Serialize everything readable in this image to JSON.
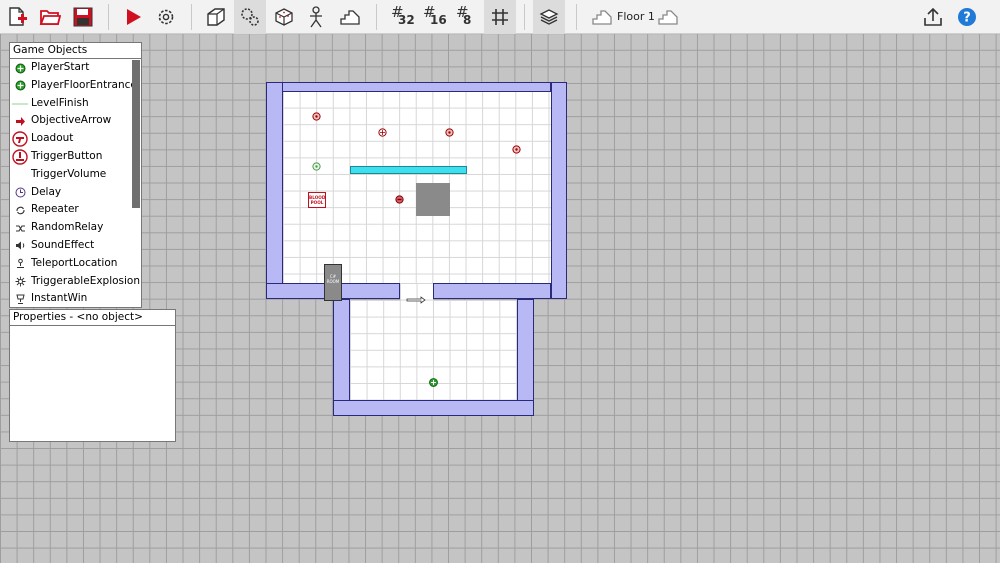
{
  "toolbar": {
    "buttons": [
      {
        "name": "new-level-icon"
      },
      {
        "name": "open-folder-icon"
      },
      {
        "name": "save-icon"
      },
      {
        "name": "play-icon"
      },
      {
        "name": "settings-gear-icon"
      },
      {
        "name": "wall-tool-icon"
      },
      {
        "name": "object-tool-icon"
      },
      {
        "name": "cube-tool-icon"
      },
      {
        "name": "player-figure-icon"
      },
      {
        "name": "stairs-tool-icon"
      }
    ],
    "grid_sizes": [
      "32",
      "16",
      "8"
    ],
    "floor_label": "Floor 1",
    "colors": {
      "accent_red": "#d01020",
      "help_blue": "#1f7ad8"
    }
  },
  "game_objects": {
    "title": "Game Objects",
    "items": [
      {
        "label": "PlayerStart",
        "icon": "green-circle-icon"
      },
      {
        "label": "PlayerFloorEntrance",
        "icon": "green-circle-icon"
      },
      {
        "label": "LevelFinish",
        "icon": "finish-line-icon"
      },
      {
        "label": "ObjectiveArrow",
        "icon": "red-arrow-icon"
      },
      {
        "label": "Loadout",
        "icon": "loadout-icon"
      },
      {
        "label": "TriggerButton",
        "icon": "trigger-button-icon"
      },
      {
        "label": "TriggerVolume",
        "icon": "none"
      },
      {
        "label": "Delay",
        "icon": "clock-icon"
      },
      {
        "label": "Repeater",
        "icon": "repeat-icon"
      },
      {
        "label": "RandomRelay",
        "icon": "shuffle-icon"
      },
      {
        "label": "SoundEffect",
        "icon": "speaker-icon"
      },
      {
        "label": "TeleportLocation",
        "icon": "teleport-icon"
      },
      {
        "label": "TriggerableExplosion",
        "icon": "explosion-icon"
      },
      {
        "label": "InstantWin",
        "icon": "trophy-icon"
      }
    ]
  },
  "properties": {
    "title": "Properties - <no object>"
  },
  "map": {
    "wall_color": "#b8b8f4",
    "wall_border": "#2a2a7a",
    "door_label_top": "C#",
    "door_label_bottom": "ROOM",
    "sign_label_top": "BLOOD",
    "sign_label_bottom": "POOL"
  }
}
